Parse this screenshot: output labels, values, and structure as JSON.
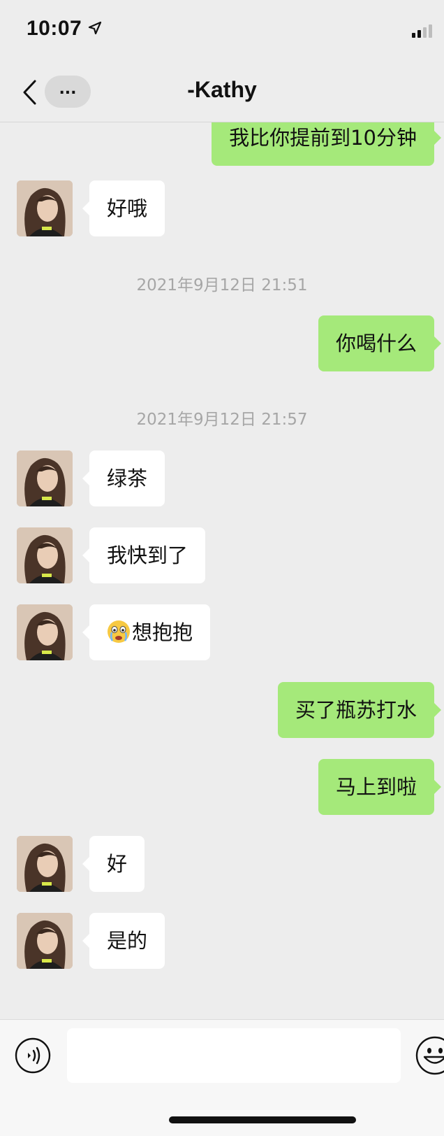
{
  "status_bar": {
    "time": "10:07"
  },
  "nav": {
    "more_label": "...",
    "title": "-Kathy"
  },
  "messages": [
    {
      "side": "out",
      "text": "我比你提前到10分钟"
    },
    {
      "side": "in",
      "text": "好哦"
    },
    {
      "timestamp": "2021年9月12日 21:51"
    },
    {
      "side": "out",
      "text": "你喝什么"
    },
    {
      "timestamp": "2021年9月12日 21:57"
    },
    {
      "side": "in",
      "text": "绿茶"
    },
    {
      "side": "in",
      "text": "我快到了"
    },
    {
      "side": "in",
      "text": "想抱抱",
      "emoji": "crying-emoji"
    },
    {
      "side": "out",
      "text": "买了瓶苏打水"
    },
    {
      "side": "out",
      "text": "马上到啦"
    },
    {
      "side": "in",
      "text": "好"
    },
    {
      "side": "in",
      "text": "是的"
    }
  ],
  "input_bar": {
    "value": ""
  },
  "colors": {
    "outgoing_bubble": "#a5e97a",
    "incoming_bubble": "#ffffff",
    "background": "#ededed"
  }
}
